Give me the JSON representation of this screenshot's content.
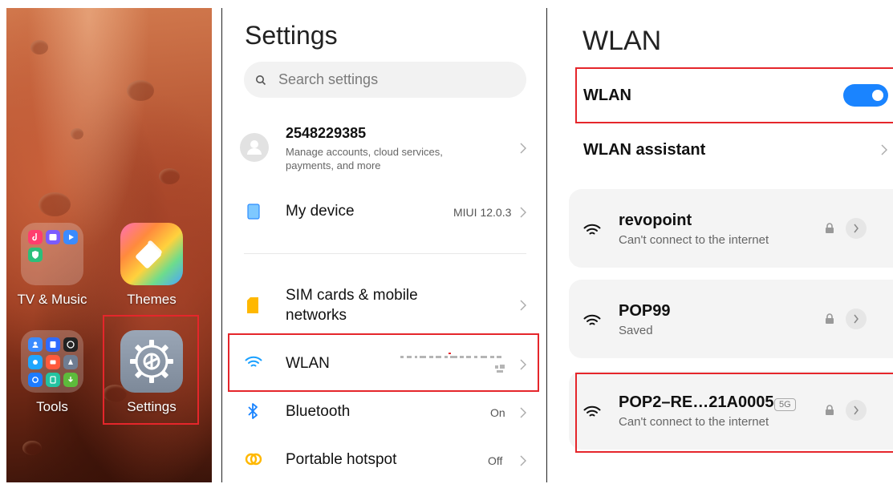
{
  "home": {
    "folder_tv_music_label": "TV & Music",
    "themes_label": "Themes",
    "tools_label": "Tools",
    "settings_label": "Settings"
  },
  "settings": {
    "title": "Settings",
    "search_placeholder": "Search settings",
    "account": {
      "id": "2548229385",
      "subtitle": "Manage accounts, cloud services, payments, and more"
    },
    "items": [
      {
        "label": "My device",
        "value": "MIUI 12.0.3",
        "icon": "device-icon"
      },
      {
        "label": "SIM cards & mobile networks",
        "value": "",
        "icon": "sim-icon"
      },
      {
        "label": "WLAN",
        "value": "",
        "icon": "wifi-icon"
      },
      {
        "label": "Bluetooth",
        "value": "On",
        "icon": "bluetooth-icon"
      },
      {
        "label": "Portable hotspot",
        "value": "Off",
        "icon": "hotspot-icon"
      }
    ]
  },
  "wlan": {
    "title": "WLAN",
    "toggle_label": "WLAN",
    "toggle_on": true,
    "assistant_label": "WLAN assistant",
    "networks": [
      {
        "name": "revopoint",
        "status": "Can't connect to the internet",
        "band": ""
      },
      {
        "name": "POP99",
        "status": "Saved",
        "band": ""
      },
      {
        "name": "POP2–RE…21A0005",
        "status": "Can't connect to the internet",
        "band": "5G"
      }
    ]
  },
  "colors": {
    "accent": "#1a84ff",
    "highlight_box": "#e5262b",
    "wifi_icon": "#1aa0ff",
    "sim_icon": "#ffb800",
    "hotspot_icon": "#ffb800"
  }
}
